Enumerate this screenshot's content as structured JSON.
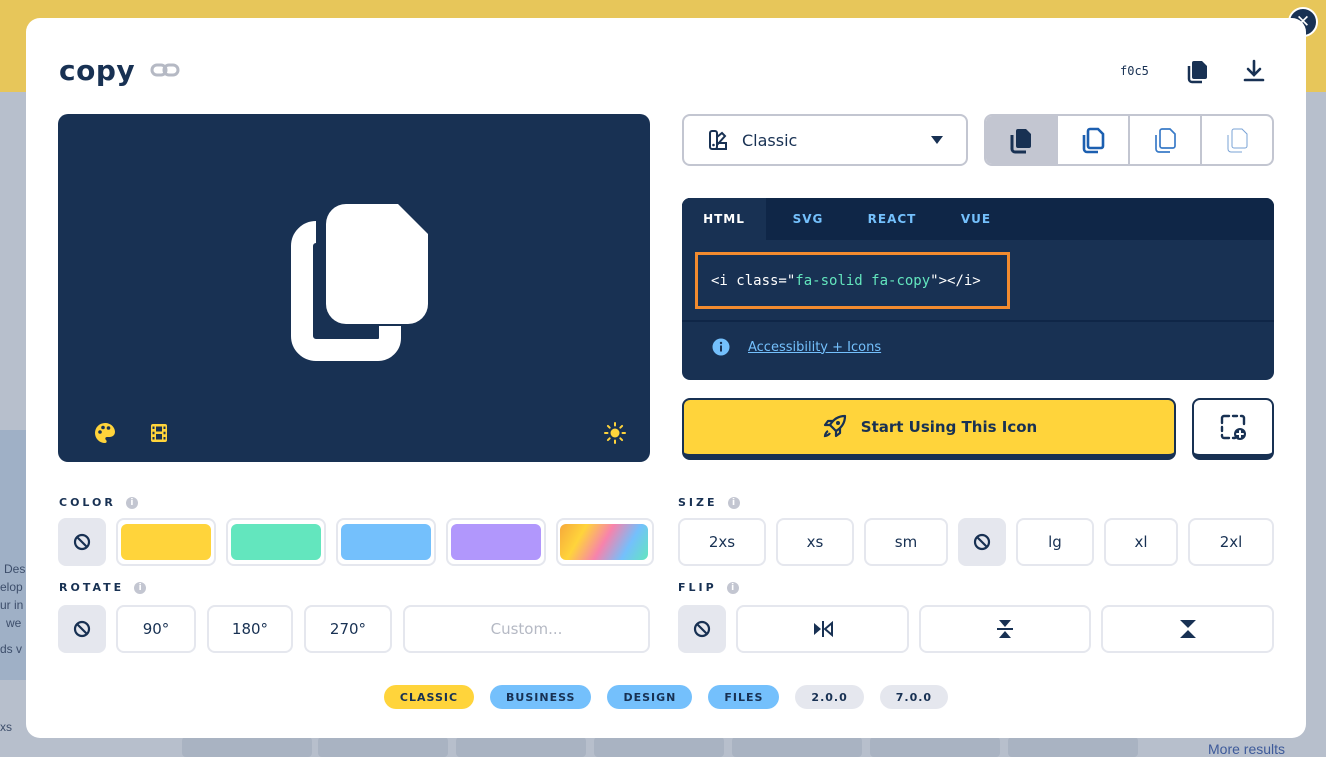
{
  "backdrop": {
    "left_text": [
      "Des",
      "elop",
      "ur in",
      "we",
      "ds v"
    ],
    "bottom_left": "xs",
    "more_results": "More results"
  },
  "modal": {
    "title": "copy",
    "unicode": "f0c5",
    "icons": {
      "link": "link-icon",
      "copy_unicode": "copy-icon",
      "download": "download-icon",
      "close": "close-icon"
    }
  },
  "preview": {
    "icon": "copy-icon",
    "tools": [
      "palette-icon",
      "film-icon",
      "sun-icon"
    ]
  },
  "style_select": {
    "selected": "Classic",
    "icon": "swatchbook-icon"
  },
  "family_variants": [
    "solid",
    "regular",
    "light",
    "thin"
  ],
  "code": {
    "tabs": [
      "HTML",
      "SVG",
      "REACT",
      "VUE"
    ],
    "active_tab": "HTML",
    "snippet_pre": "<i class=",
    "snippet_q1": "\"",
    "snippet_class": "fa-solid fa-copy",
    "snippet_q2": "\"",
    "snippet_post": "></i>",
    "a11y_link": "Accessibility + Icons"
  },
  "start_button": "Start Using This Icon",
  "color": {
    "label": "COLOR",
    "swatches": [
      "#ffd43b",
      "#63e6be",
      "#74c0fc",
      "#b197fc",
      "gradient"
    ]
  },
  "size": {
    "label": "SIZE",
    "options": [
      "2xs",
      "xs",
      "sm",
      "lg",
      "xl",
      "2xl"
    ]
  },
  "rotate": {
    "label": "ROTATE",
    "options": [
      "90°",
      "180°",
      "270°"
    ],
    "custom_placeholder": "Custom..."
  },
  "flip": {
    "label": "FLIP",
    "options": [
      "flip-horizontal-icon",
      "flip-vertical-icon",
      "flip-both-icon"
    ]
  },
  "tags": [
    {
      "label": "CLASSIC",
      "kind": "y"
    },
    {
      "label": "BUSINESS",
      "kind": "b"
    },
    {
      "label": "DESIGN",
      "kind": "b"
    },
    {
      "label": "FILES",
      "kind": "b"
    },
    {
      "label": "2.0.0",
      "kind": "g"
    },
    {
      "label": "7.0.0",
      "kind": "g"
    }
  ],
  "colors": {
    "navy": "#183153",
    "yellow": "#ffd43b",
    "teal": "#63e6be",
    "blue": "#74c0fc",
    "purple": "#b197fc",
    "highlight": "#f28b2f"
  }
}
